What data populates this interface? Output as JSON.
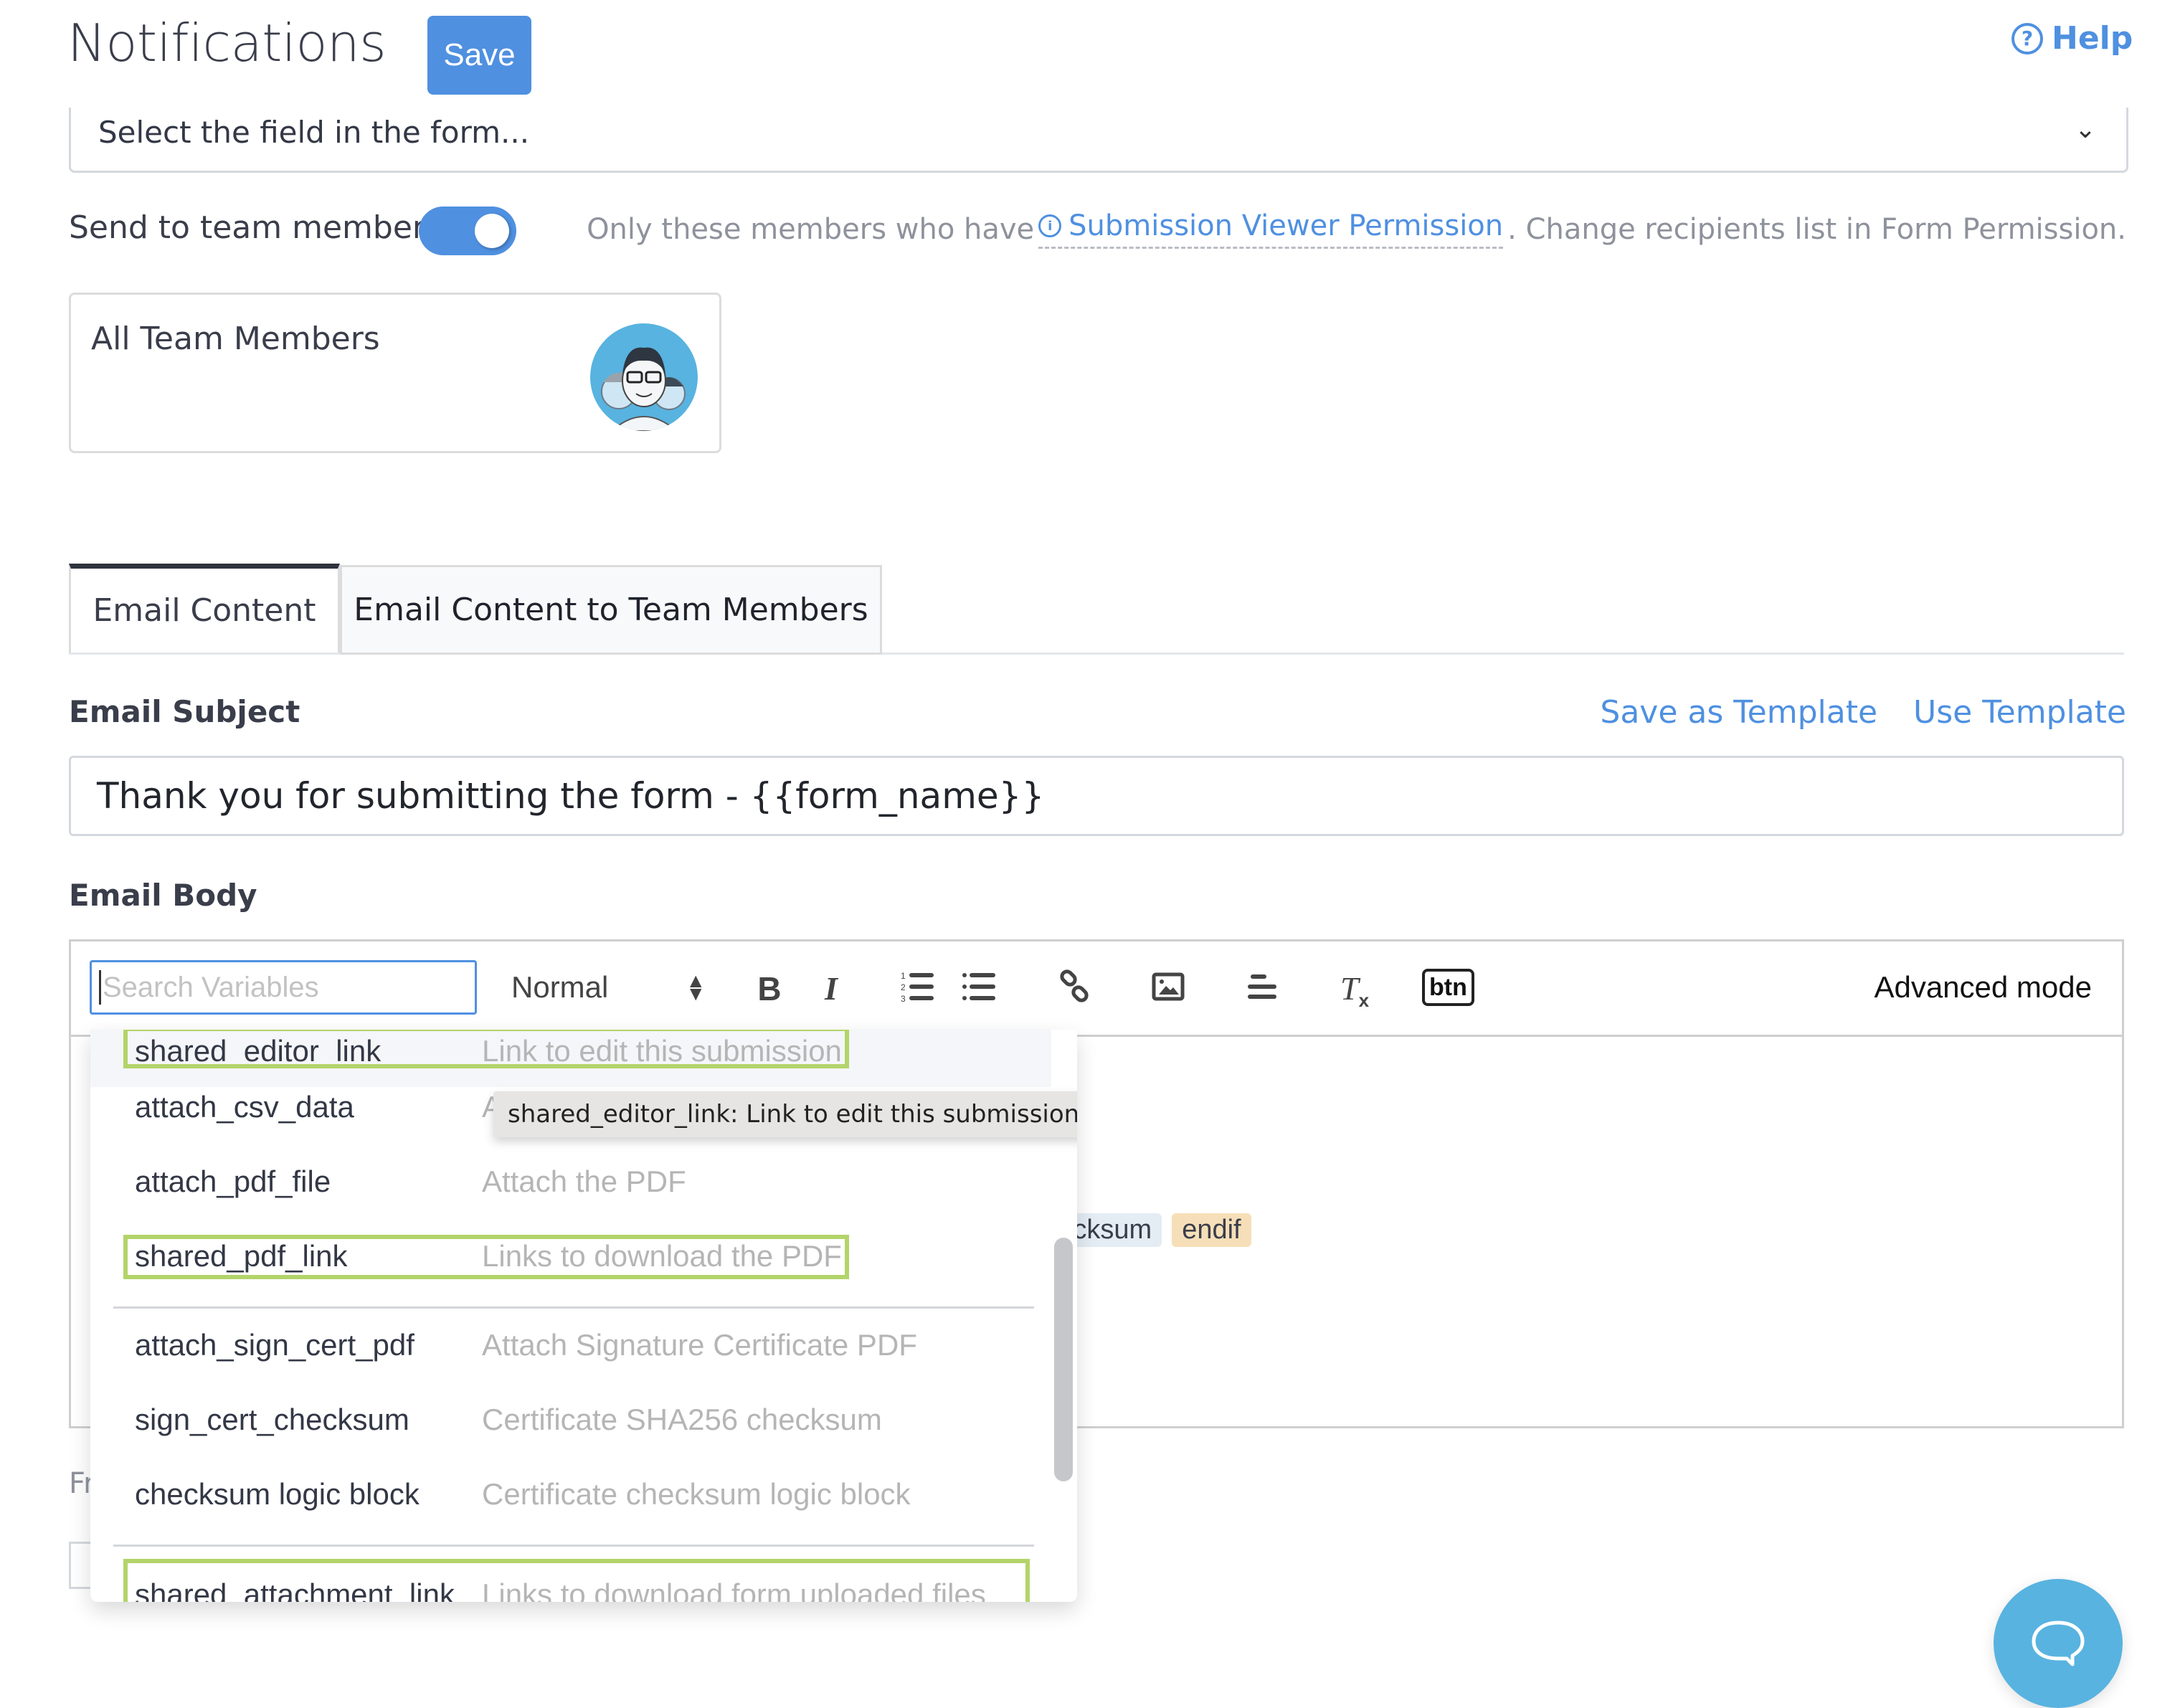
{
  "header": {
    "title": "Notifications",
    "save_label": "Save",
    "help_label": "Help"
  },
  "field_select": {
    "value": "Select the field in the form..."
  },
  "team": {
    "toggle_label": "Send to team members",
    "toggle_on": true,
    "note_prefix": "Only these members who have",
    "permission_link": "Submission Viewer Permission",
    "note_suffix": ". Change recipients list in Form Permission.",
    "card_label": "All Team Members"
  },
  "tabs": [
    {
      "label": "Email Content",
      "active": true
    },
    {
      "label": "Email Content to Team Members",
      "active": false
    }
  ],
  "subject": {
    "label": "Email Subject",
    "save_template": "Save as Template",
    "use_template": "Use Template",
    "value": "Thank you for submitting the form - {{form_name}}"
  },
  "body": {
    "label": "Email Body",
    "search_placeholder": "Search Variables",
    "format_value": "Normal",
    "advanced_mode": "Advanced mode",
    "btn_label": "btn",
    "chips": [
      {
        "text": "_checksum",
        "color": "#e4ecf4"
      },
      {
        "text": "endif",
        "color": "#f6dfb8"
      }
    ]
  },
  "from_label": "Fr",
  "variables_dropdown": {
    "items": [
      {
        "name": "shared_editor_link",
        "desc": "Link to edit this submission",
        "highlighted": true
      },
      {
        "name": "attach_csv_data",
        "desc": "A",
        "highlighted": false
      },
      {
        "name": "attach_pdf_file",
        "desc": "Attach the PDF",
        "highlighted": false
      },
      {
        "name": "shared_pdf_link",
        "desc": "Links to download the PDF",
        "highlighted": true
      },
      {
        "name": "attach_sign_cert_pdf",
        "desc": "Attach Signature Certificate PDF",
        "highlighted": false
      },
      {
        "name": "sign_cert_checksum",
        "desc": "Certificate SHA256 checksum",
        "highlighted": false
      },
      {
        "name": "checksum logic block",
        "desc": "Certificate checksum logic block",
        "highlighted": false
      },
      {
        "name": "shared_attachment_link",
        "desc": "Links to download form uploaded files",
        "highlighted": true
      }
    ],
    "tooltip": "shared_editor_link: Link to edit this submission"
  },
  "colors": {
    "accent": "#4f90e0",
    "highlight_border": "#b3d46a",
    "chat_button": "#58b3e0"
  }
}
